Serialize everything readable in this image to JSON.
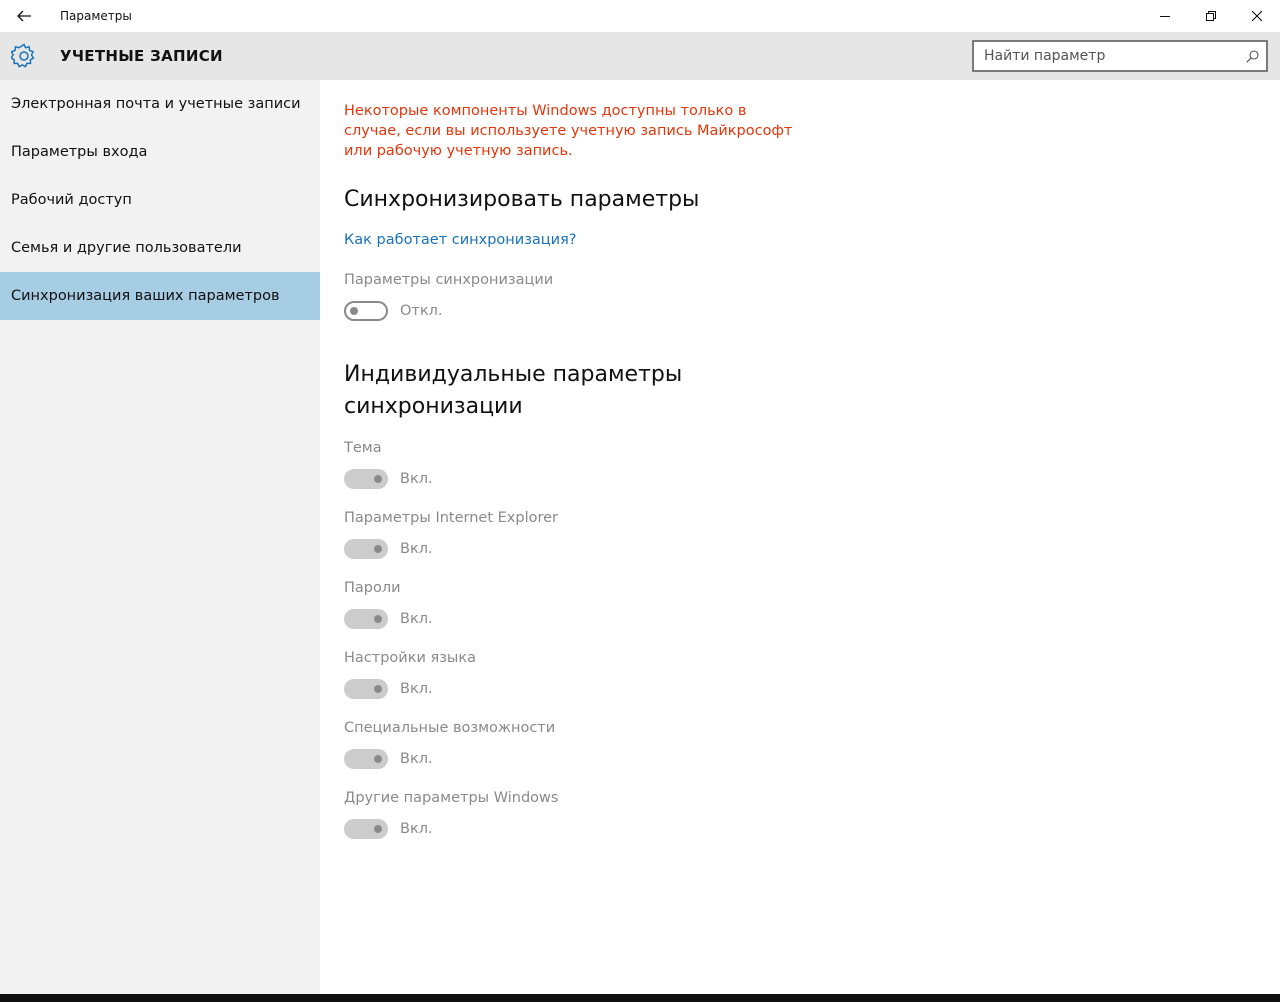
{
  "window": {
    "app_title": "Параметры"
  },
  "header": {
    "section_title": "УЧЕТНЫЕ ЗАПИСИ",
    "search_placeholder": "Найти параметр",
    "accent_color": "#1a73b8"
  },
  "sidebar": {
    "items": [
      {
        "label": "Электронная почта и учетные записи",
        "active": false
      },
      {
        "label": "Параметры входа",
        "active": false
      },
      {
        "label": "Рабочий доступ",
        "active": false
      },
      {
        "label": "Семья и другие пользователи",
        "active": false
      },
      {
        "label": "Синхронизация ваших параметров",
        "active": true
      }
    ]
  },
  "content": {
    "warning": "Некоторые компоненты Windows доступны только в случае, если вы используете учетную запись Майкрософт или рабочую учетную запись.",
    "sync_heading": "Синхронизировать параметры",
    "how_link": "Как работает синхронизация?",
    "sync_settings_label": "Параметры синхронизации",
    "sync_settings_state": "Откл.",
    "individual_heading_line1": "Индивидуальные параметры",
    "individual_heading_line2": "синхронизации",
    "individual": [
      {
        "label": "Тема",
        "state": "Вкл."
      },
      {
        "label": "Параметры Internet Explorer",
        "state": "Вкл."
      },
      {
        "label": "Пароли",
        "state": "Вкл."
      },
      {
        "label": "Настройки языка",
        "state": "Вкл."
      },
      {
        "label": "Специальные возможности",
        "state": "Вкл."
      },
      {
        "label": "Другие параметры Windows",
        "state": "Вкл."
      }
    ]
  }
}
